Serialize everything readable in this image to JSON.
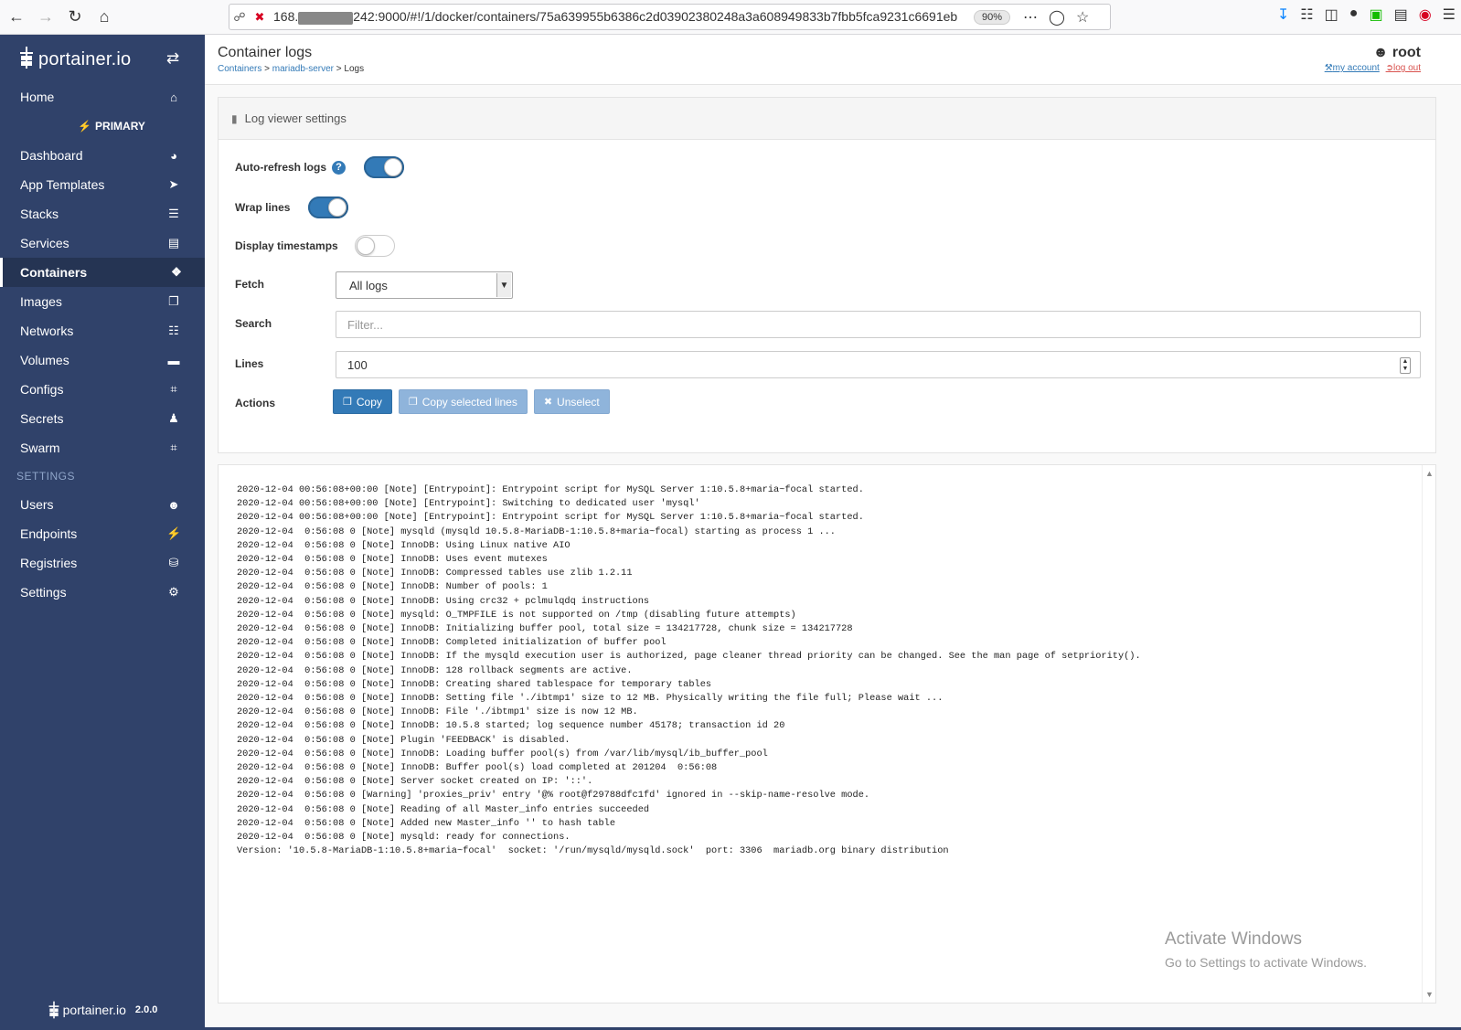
{
  "browser": {
    "url_prefix": "168.",
    "url_suffix": "242:9000/#!/1/docker/containers/75a639955b6386c2d03902380248a3a608949833b7fbb5fca9231c6691eb",
    "zoom": "90%"
  },
  "sidebar": {
    "brand": "portainer.io",
    "environment": "PRIMARY",
    "home_label": "Home",
    "items": [
      {
        "label": "Dashboard",
        "icon": "dashboard-icon"
      },
      {
        "label": "App Templates",
        "icon": "rocket-icon"
      },
      {
        "label": "Stacks",
        "icon": "list-icon"
      },
      {
        "label": "Services",
        "icon": "services-icon"
      },
      {
        "label": "Containers",
        "icon": "cubes-icon",
        "active": true
      },
      {
        "label": "Images",
        "icon": "clone-icon"
      },
      {
        "label": "Networks",
        "icon": "sitemap-icon"
      },
      {
        "label": "Volumes",
        "icon": "hdd-icon"
      },
      {
        "label": "Configs",
        "icon": "file-code-icon"
      },
      {
        "label": "Secrets",
        "icon": "user-secret-icon"
      },
      {
        "label": "Swarm",
        "icon": "object-group-icon"
      }
    ],
    "settings_section": "SETTINGS",
    "settings_items": [
      {
        "label": "Users",
        "icon": "users-icon"
      },
      {
        "label": "Endpoints",
        "icon": "plug-icon"
      },
      {
        "label": "Registries",
        "icon": "database-icon"
      },
      {
        "label": "Settings",
        "icon": "cogs-icon"
      }
    ],
    "footer_brand": "portainer.io",
    "version": "2.0.0"
  },
  "header": {
    "title": "Container logs",
    "breadcrumb": {
      "containers": "Containers",
      "sep": " > ",
      "container": "mariadb-server",
      "current": "Logs"
    },
    "user": "root",
    "my_account": "my account",
    "log_out": "log out"
  },
  "settings": {
    "panel_title": "Log viewer settings",
    "auto_refresh_label": "Auto-refresh logs",
    "auto_refresh": true,
    "wrap_lines_label": "Wrap lines",
    "wrap_lines": true,
    "timestamps_label": "Display timestamps",
    "timestamps": false,
    "fetch_label": "Fetch",
    "fetch_value": "All logs",
    "search_label": "Search",
    "search_placeholder": "Filter...",
    "lines_label": "Lines",
    "lines_value": "100",
    "actions_label": "Actions",
    "copy_label": "Copy",
    "copy_selected_label": "Copy selected lines",
    "unselect_label": "Unselect"
  },
  "logs": [
    "2020-12-04 00:56:08+00:00 [Note] [Entrypoint]: Entrypoint script for MySQL Server 1:10.5.8+maria~focal started.",
    "2020-12-04 00:56:08+00:00 [Note] [Entrypoint]: Switching to dedicated user 'mysql'",
    "2020-12-04 00:56:08+00:00 [Note] [Entrypoint]: Entrypoint script for MySQL Server 1:10.5.8+maria~focal started.",
    "2020-12-04  0:56:08 0 [Note] mysqld (mysqld 10.5.8-MariaDB-1:10.5.8+maria~focal) starting as process 1 ...",
    "2020-12-04  0:56:08 0 [Note] InnoDB: Using Linux native AIO",
    "2020-12-04  0:56:08 0 [Note] InnoDB: Uses event mutexes",
    "2020-12-04  0:56:08 0 [Note] InnoDB: Compressed tables use zlib 1.2.11",
    "2020-12-04  0:56:08 0 [Note] InnoDB: Number of pools: 1",
    "2020-12-04  0:56:08 0 [Note] InnoDB: Using crc32 + pclmulqdq instructions",
    "2020-12-04  0:56:08 0 [Note] mysqld: O_TMPFILE is not supported on /tmp (disabling future attempts)",
    "2020-12-04  0:56:08 0 [Note] InnoDB: Initializing buffer pool, total size = 134217728, chunk size = 134217728",
    "2020-12-04  0:56:08 0 [Note] InnoDB: Completed initialization of buffer pool",
    "2020-12-04  0:56:08 0 [Note] InnoDB: If the mysqld execution user is authorized, page cleaner thread priority can be changed. See the man page of setpriority().",
    "2020-12-04  0:56:08 0 [Note] InnoDB: 128 rollback segments are active.",
    "2020-12-04  0:56:08 0 [Note] InnoDB: Creating shared tablespace for temporary tables",
    "2020-12-04  0:56:08 0 [Note] InnoDB: Setting file './ibtmp1' size to 12 MB. Physically writing the file full; Please wait ...",
    "2020-12-04  0:56:08 0 [Note] InnoDB: File './ibtmp1' size is now 12 MB.",
    "2020-12-04  0:56:08 0 [Note] InnoDB: 10.5.8 started; log sequence number 45178; transaction id 20",
    "2020-12-04  0:56:08 0 [Note] Plugin 'FEEDBACK' is disabled.",
    "2020-12-04  0:56:08 0 [Note] InnoDB: Loading buffer pool(s) from /var/lib/mysql/ib_buffer_pool",
    "2020-12-04  0:56:08 0 [Note] InnoDB: Buffer pool(s) load completed at 201204  0:56:08",
    "2020-12-04  0:56:08 0 [Note] Server socket created on IP: '::'.",
    "2020-12-04  0:56:08 0 [Warning] 'proxies_priv' entry '@% root@f29788dfc1fd' ignored in --skip-name-resolve mode.",
    "2020-12-04  0:56:08 0 [Note] Reading of all Master_info entries succeeded",
    "2020-12-04  0:56:08 0 [Note] Added new Master_info '' to hash table",
    "2020-12-04  0:56:08 0 [Note] mysqld: ready for connections.",
    "Version: '10.5.8-MariaDB-1:10.5.8+maria~focal'  socket: '/run/mysqld/mysqld.sock'  port: 3306  mariadb.org binary distribution"
  ],
  "watermark": {
    "line1": "Activate Windows",
    "line2": "Go to Settings to activate Windows."
  },
  "colors": {
    "sidebar": "#30426a",
    "primary": "#337ab7"
  }
}
